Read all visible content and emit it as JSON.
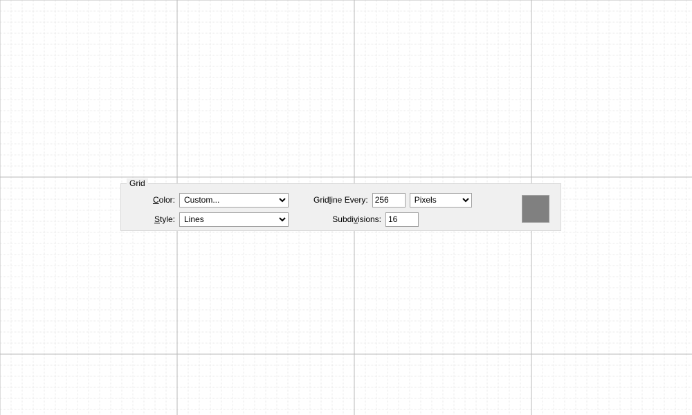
{
  "panel": {
    "legend": "Grid",
    "color_label": "Color:",
    "color_value": "Custom...",
    "style_label": "Style:",
    "style_value": "Lines",
    "gridline_label_pre": "Grid",
    "gridline_label_u": "l",
    "gridline_label_post": "ine Every:",
    "gridline_value": "256",
    "units_value": "Pixels",
    "subdiv_label_pre": "Subdi",
    "subdiv_label_u": "v",
    "subdiv_label_post": "isions:",
    "subdiv_value": "16",
    "swatch_color": "#808080"
  },
  "grid": {
    "major": 256,
    "sub": 16,
    "majorColor": "#b8b8b8",
    "minorColor": "#e8e8e8"
  },
  "labels": {
    "color_u": "C",
    "color_post": "olor:",
    "style_u": "S",
    "style_post": "tyle:"
  }
}
